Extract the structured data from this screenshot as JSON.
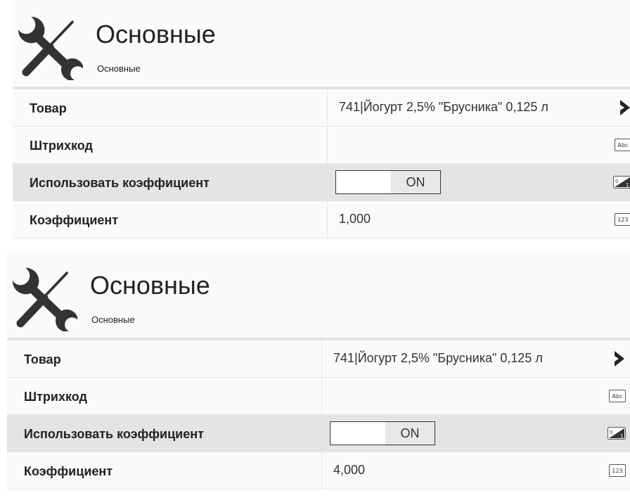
{
  "panels": [
    {
      "header": {
        "title": "Основные",
        "subtitle": "Основные",
        "icon": "tools-icon"
      },
      "rows": [
        {
          "label": "Товар",
          "value": "741|Йогурт 2,5% \"Брусника\" 0,125 л",
          "icon": "chevron-right-icon"
        },
        {
          "label": "Штрихкод",
          "value": "",
          "icon": "text-type-icon",
          "badge": "Abc"
        },
        {
          "label": "Использовать коэффициент",
          "toggle": "ON",
          "icon": "boolean-type-icon"
        },
        {
          "label": "Коэффициент",
          "value": "1,000",
          "icon": "number-type-icon",
          "badge": "123"
        }
      ]
    },
    {
      "header": {
        "title": "Основные",
        "subtitle": "Основные",
        "icon": "tools-icon"
      },
      "rows": [
        {
          "label": "Товар",
          "value": "741|Йогурт 2,5% \"Брусника\" 0,125 л",
          "icon": "chevron-right-icon"
        },
        {
          "label": "Штрихкод",
          "value": "",
          "icon": "text-type-icon",
          "badge": "Abc"
        },
        {
          "label": "Использовать коэффициент",
          "toggle": "ON",
          "icon": "boolean-type-icon"
        },
        {
          "label": "Коэффициент",
          "value": "4,000",
          "icon": "number-type-icon",
          "badge": "123"
        }
      ]
    }
  ]
}
